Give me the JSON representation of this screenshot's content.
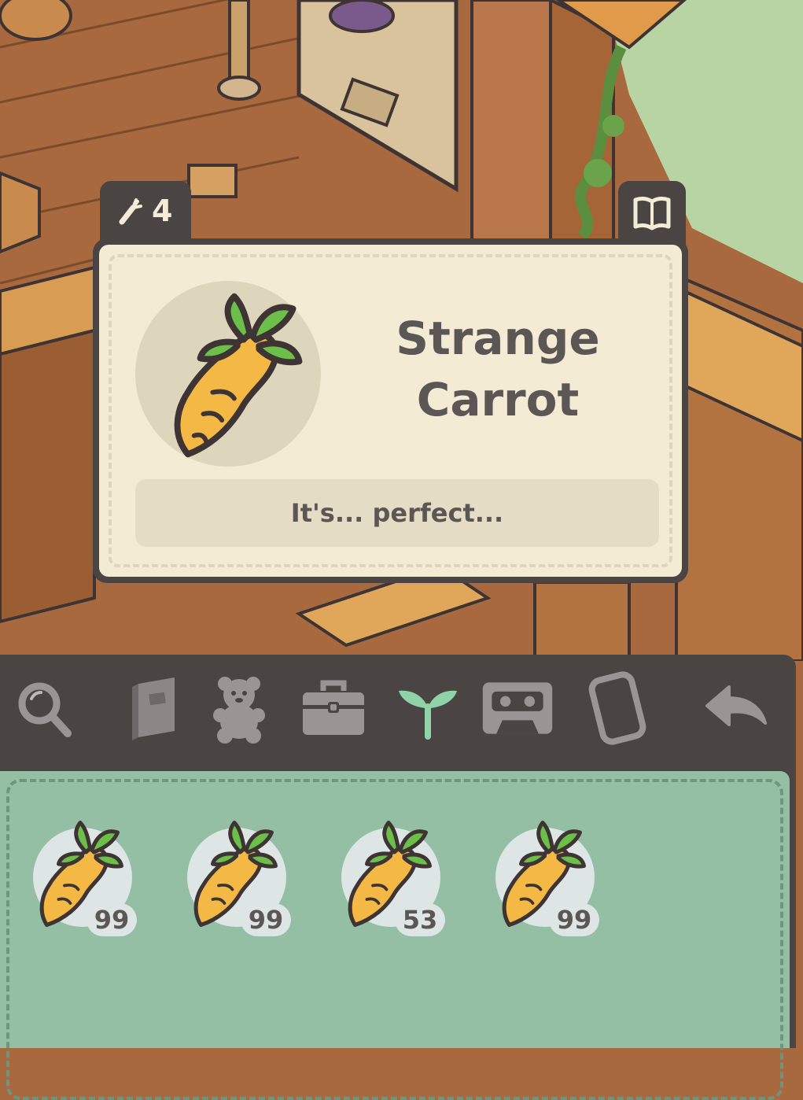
{
  "item_card": {
    "count": "4",
    "name": "Strange Carrot",
    "description": "It's... perfect..."
  },
  "toolbar": {
    "tools": [
      {
        "icon": "magnifier-icon",
        "active": false
      },
      {
        "icon": "journal-icon",
        "active": false
      },
      {
        "icon": "teddy-bear-icon",
        "active": false
      },
      {
        "icon": "toolbox-icon",
        "active": false
      },
      {
        "icon": "sprout-icon",
        "active": true
      },
      {
        "icon": "cassette-icon",
        "active": false
      },
      {
        "icon": "phone-icon",
        "active": false
      },
      {
        "icon": "back-arrow-icon",
        "active": false
      }
    ]
  },
  "inventory": {
    "slots": [
      {
        "item": "Strange Carrot",
        "qty": "99"
      },
      {
        "item": "Strange Carrot",
        "qty": "99"
      },
      {
        "item": "Strange Carrot",
        "qty": "53"
      },
      {
        "item": "Strange Carrot",
        "qty": "99"
      }
    ]
  },
  "colors": {
    "panel_dark": "#4a4443",
    "card_bg": "#f3ebd4",
    "inventory_bg": "#94bfa4",
    "active_tool": "#8fd3a8",
    "inactive_tool": "#9a9594"
  }
}
